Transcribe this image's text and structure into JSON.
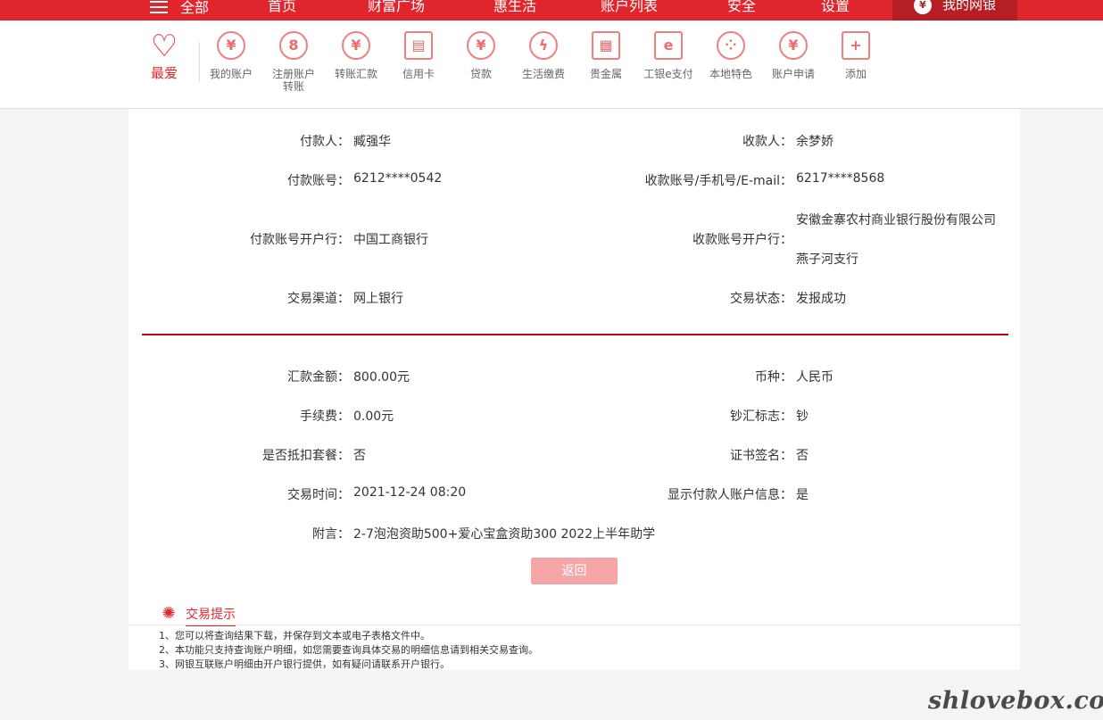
{
  "topnav": {
    "menu_label": "全部",
    "items": [
      "首页",
      "财富广场",
      "惠生活",
      "账户列表",
      "安全",
      "设置"
    ],
    "mybank": "我的网银",
    "mybank_logo": "¥"
  },
  "shortcuts": {
    "favorite": "最爱",
    "items": [
      {
        "label": "我的账户",
        "icon": "¥"
      },
      {
        "label": "注册账户\n转账",
        "icon": "8"
      },
      {
        "label": "转账汇款",
        "icon": "¥"
      },
      {
        "label": "信用卡",
        "icon": "▤"
      },
      {
        "label": "贷款",
        "icon": "¥"
      },
      {
        "label": "生活缴费",
        "icon": "ϟ"
      },
      {
        "label": "贵金属",
        "icon": "▦"
      },
      {
        "label": "工银e支付",
        "icon": "e"
      },
      {
        "label": "本地特色",
        "icon": "⁘"
      },
      {
        "label": "账户申请",
        "icon": "¥"
      },
      {
        "label": "添加",
        "icon": "+"
      }
    ]
  },
  "detail": {
    "payer_label": "付款人：",
    "payer": "臧强华",
    "payee_label": "收款人：",
    "payee": "余梦娇",
    "payer_acct_label": "付款账号：",
    "payer_acct": "6212****0542",
    "payee_acct_label": "收款账号/手机号/E-mail：",
    "payee_acct": "6217****8568",
    "payer_bank_label": "付款账号开户行：",
    "payer_bank": "中国工商银行",
    "payee_bank_label": "收款账号开户行：",
    "payee_bank_line1": "安徽金寨农村商业银行股份有限公司",
    "payee_bank_line2": "燕子河支行",
    "channel_label": "交易渠道：",
    "channel": "网上银行",
    "status_label": "交易状态：",
    "status": "发报成功",
    "amount_label": "汇款金额：",
    "amount": "800.00元",
    "currency_label": "币种：",
    "currency": "人民币",
    "fee_label": "手续费：",
    "fee": "0.00元",
    "cash_label": "钞汇标志：",
    "cash": "钞",
    "package_label": "是否抵扣套餐：",
    "package": "否",
    "cert_label": "证书签名：",
    "cert": "否",
    "time_label": "交易时间：",
    "time": "2021-12-24 08:20",
    "show_payer_label": "显示付款人账户信息：",
    "show_payer": "是",
    "note_label": "附言：",
    "note": "2-7泡泡资助500+爱心宝盒资助300 2022上半年助学",
    "back_button": "返回"
  },
  "tips": {
    "title": "交易提示",
    "items": [
      "1、您可以将查询结果下载，并保存到文本或电子表格文件中。",
      "2、本功能只支持查询账户明细，如您需要查询具体交易的明细信息请到相关交易查询。",
      "3、网银互联账户明细由开户银行提供，如有疑问请联系开户银行。"
    ]
  },
  "watermark": "shlovebox.com",
  "colors": {
    "brand_red": "#e0262c",
    "divider_red": "#c0000d",
    "button_pink": "#f6a6a8"
  }
}
